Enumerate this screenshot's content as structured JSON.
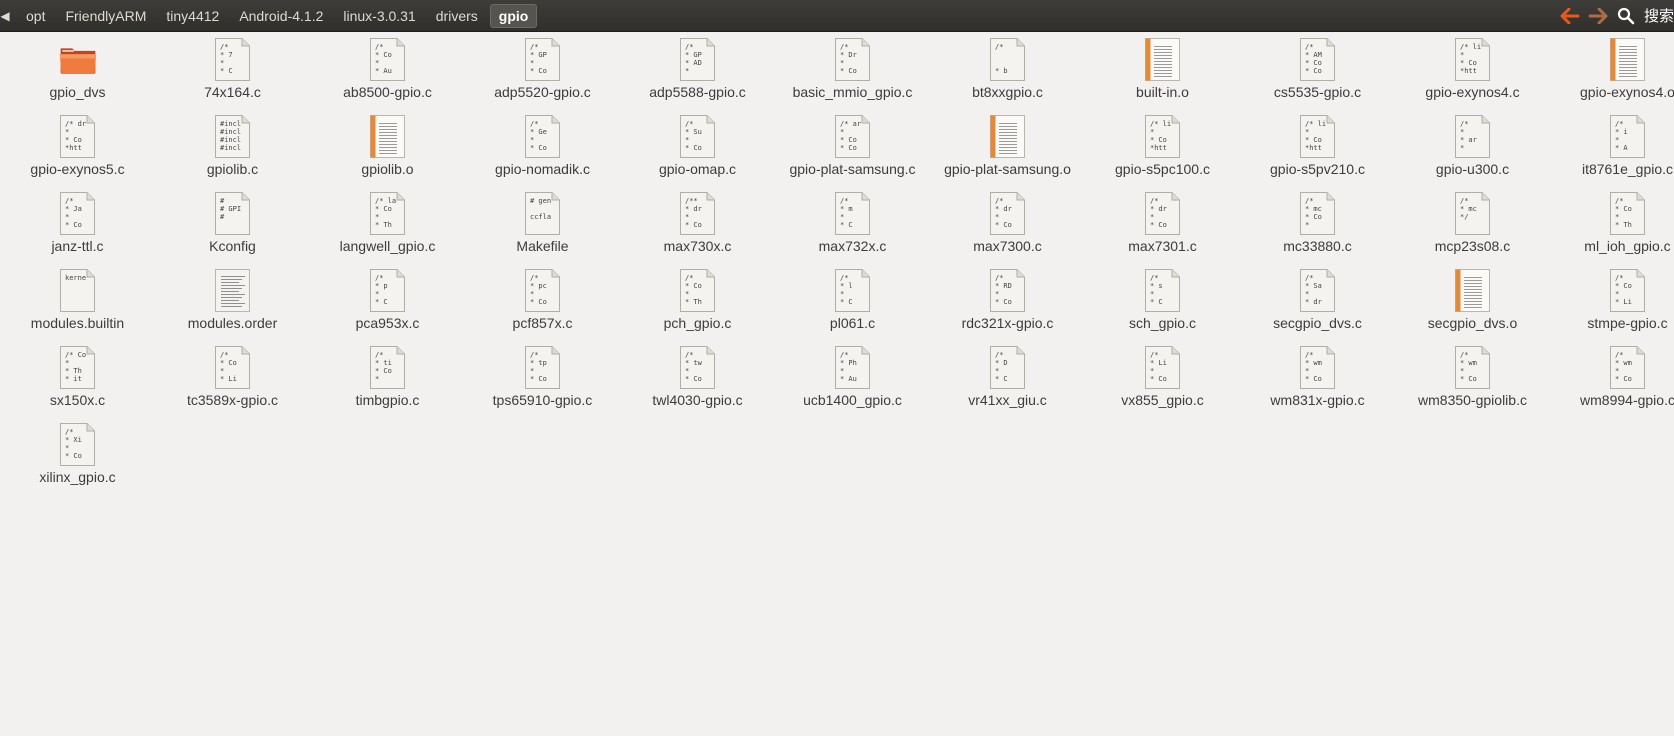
{
  "breadcrumb": {
    "items": [
      "opt",
      "FriendlyARM",
      "tiny4412",
      "Android-4.1.2",
      "linux-3.0.31",
      "drivers",
      "gpio"
    ],
    "active_index": 6
  },
  "toolbar": {
    "search_label": "搜索"
  },
  "colors": {
    "topbar": "#3c3b37",
    "accent_orange": "#e9591e",
    "background": "#f2f1f0"
  },
  "files": [
    {
      "name": "gpio_dvs",
      "type": "folder",
      "icon_text": []
    },
    {
      "name": "74x164.c",
      "type": "code",
      "icon_text": [
        "/*",
        "* 7",
        "*",
        "* C"
      ]
    },
    {
      "name": "ab8500-gpio.c",
      "type": "code",
      "icon_text": [
        "/*",
        "* Co",
        "*",
        "* Au"
      ]
    },
    {
      "name": "adp5520-gpio.c",
      "type": "code",
      "icon_text": [
        "/*",
        "* GP",
        "*",
        "* Co"
      ]
    },
    {
      "name": "adp5588-gpio.c",
      "type": "code",
      "icon_text": [
        "/*",
        "* GP",
        "* AD",
        "*"
      ]
    },
    {
      "name": "basic_mmio_gpio.c",
      "type": "code",
      "icon_text": [
        "/*",
        "* Dr",
        "*",
        "* Co"
      ]
    },
    {
      "name": "bt8xxgpio.c",
      "type": "code",
      "icon_text": [
        "/*",
        "",
        "",
        "* b"
      ]
    },
    {
      "name": "built-in.o",
      "type": "object",
      "icon_text": []
    },
    {
      "name": "cs5535-gpio.c",
      "type": "code",
      "icon_text": [
        "/*",
        "* AM",
        "* Co",
        "* Co"
      ]
    },
    {
      "name": "gpio-exynos4.c",
      "type": "code",
      "icon_text": [
        "/* li",
        "*",
        "* Co",
        "*htt"
      ]
    },
    {
      "name": "gpio-exynos4.o",
      "type": "object",
      "icon_text": []
    },
    {
      "name": "gpio-exynos5.c",
      "type": "code",
      "icon_text": [
        "/* dr",
        "*",
        "* Co",
        "*htt"
      ]
    },
    {
      "name": "gpiolib.c",
      "type": "code",
      "icon_text": [
        "#incl",
        "#incl",
        "#incl",
        "#incl"
      ]
    },
    {
      "name": "gpiolib.o",
      "type": "object",
      "icon_text": []
    },
    {
      "name": "gpio-nomadik.c",
      "type": "code",
      "icon_text": [
        "/*",
        "* Ge",
        "*",
        "* Co"
      ]
    },
    {
      "name": "gpio-omap.c",
      "type": "code",
      "icon_text": [
        "/*",
        "* Su",
        "*",
        "* Co"
      ]
    },
    {
      "name": "gpio-plat-samsung.c",
      "type": "code",
      "icon_text": [
        "/* ar",
        "*",
        "* Co",
        "* Co"
      ]
    },
    {
      "name": "gpio-plat-samsung.o",
      "type": "object",
      "icon_text": []
    },
    {
      "name": "gpio-s5pc100.c",
      "type": "code",
      "icon_text": [
        "/* li",
        "*",
        "* Co",
        "*htt"
      ]
    },
    {
      "name": "gpio-s5pv210.c",
      "type": "code",
      "icon_text": [
        "/* li",
        "*",
        "* Co",
        "*htt"
      ]
    },
    {
      "name": "gpio-u300.c",
      "type": "code",
      "icon_text": [
        "/*",
        "*",
        "* ar",
        "*"
      ]
    },
    {
      "name": "it8761e_gpio.c",
      "type": "code",
      "icon_text": [
        "/*",
        "* i",
        "*",
        "* A"
      ]
    },
    {
      "name": "janz-ttl.c",
      "type": "code",
      "icon_text": [
        "/*",
        "* Ja",
        "*",
        "* Co"
      ]
    },
    {
      "name": "Kconfig",
      "type": "code",
      "icon_text": [
        "#",
        "# GPI",
        "#",
        ""
      ]
    },
    {
      "name": "langwell_gpio.c",
      "type": "code",
      "icon_text": [
        "/* la",
        "* Co",
        "*",
        "* Th"
      ]
    },
    {
      "name": "Makefile",
      "type": "code",
      "icon_text": [
        "# gen",
        "",
        "ccfla",
        ""
      ]
    },
    {
      "name": "max730x.c",
      "type": "code",
      "icon_text": [
        "/**",
        "* dr",
        "*",
        "* Co"
      ]
    },
    {
      "name": "max732x.c",
      "type": "code",
      "icon_text": [
        "/*",
        "* m",
        "*",
        "* C"
      ]
    },
    {
      "name": "max7300.c",
      "type": "code",
      "icon_text": [
        "/*",
        "* dr",
        "*",
        "* Co"
      ]
    },
    {
      "name": "max7301.c",
      "type": "code",
      "icon_text": [
        "/*",
        "* dr",
        "*",
        "* Co"
      ]
    },
    {
      "name": "mc33880.c",
      "type": "code",
      "icon_text": [
        "/*",
        "* mc",
        "* Co",
        "*"
      ]
    },
    {
      "name": "mcp23s08.c",
      "type": "code",
      "icon_text": [
        "/*",
        "* mc",
        "*/",
        ""
      ]
    },
    {
      "name": "ml_ioh_gpio.c",
      "type": "code",
      "icon_text": [
        "/*",
        "* Co",
        "*",
        "* Th"
      ]
    },
    {
      "name": "modules.builtin",
      "type": "code",
      "icon_text": [
        "kerne",
        "",
        "",
        ""
      ]
    },
    {
      "name": "modules.order",
      "type": "text",
      "icon_text": []
    },
    {
      "name": "pca953x.c",
      "type": "code",
      "icon_text": [
        "/*",
        "* p",
        "*",
        "* C"
      ]
    },
    {
      "name": "pcf857x.c",
      "type": "code",
      "icon_text": [
        "/*",
        "* pc",
        "*",
        "* Co"
      ]
    },
    {
      "name": "pch_gpio.c",
      "type": "code",
      "icon_text": [
        "/*",
        "* Co",
        "*",
        "* Th"
      ]
    },
    {
      "name": "pl061.c",
      "type": "code",
      "icon_text": [
        "/*",
        "* l",
        "*",
        "* C"
      ]
    },
    {
      "name": "rdc321x-gpio.c",
      "type": "code",
      "icon_text": [
        "/*",
        "* RD",
        "*",
        "* Co"
      ]
    },
    {
      "name": "sch_gpio.c",
      "type": "code",
      "icon_text": [
        "/*",
        "* s",
        "*",
        "* C"
      ]
    },
    {
      "name": "secgpio_dvs.c",
      "type": "code",
      "icon_text": [
        "/*",
        "* Sa",
        "*",
        "* dr"
      ]
    },
    {
      "name": "secgpio_dvs.o",
      "type": "object",
      "icon_text": []
    },
    {
      "name": "stmpe-gpio.c",
      "type": "code",
      "icon_text": [
        "/*",
        "* Co",
        "*",
        "* Li"
      ]
    },
    {
      "name": "sx150x.c",
      "type": "code",
      "icon_text": [
        "/* Co",
        "*",
        "* Th",
        "* it"
      ]
    },
    {
      "name": "tc3589x-gpio.c",
      "type": "code",
      "icon_text": [
        "/*",
        "* Co",
        "*",
        "* Li"
      ]
    },
    {
      "name": "timbgpio.c",
      "type": "code",
      "icon_text": [
        "/*",
        "* ti",
        "* Co",
        "*"
      ]
    },
    {
      "name": "tps65910-gpio.c",
      "type": "code",
      "icon_text": [
        "/*",
        "* tp",
        "*",
        "* Co"
      ]
    },
    {
      "name": "twl4030-gpio.c",
      "type": "code",
      "icon_text": [
        "/*",
        "* tw",
        "*",
        "* Co"
      ]
    },
    {
      "name": "ucb1400_gpio.c",
      "type": "code",
      "icon_text": [
        "/*",
        "* Ph",
        "*",
        "* Au"
      ]
    },
    {
      "name": "vr41xx_giu.c",
      "type": "code",
      "icon_text": [
        "/*",
        "* D",
        "*",
        "* C"
      ]
    },
    {
      "name": "vx855_gpio.c",
      "type": "code",
      "icon_text": [
        "/*",
        "* Li",
        "*",
        "* Co"
      ]
    },
    {
      "name": "wm831x-gpio.c",
      "type": "code",
      "icon_text": [
        "/*",
        "* wm",
        "*",
        "* Co"
      ]
    },
    {
      "name": "wm8350-gpiolib.c",
      "type": "code",
      "icon_text": [
        "/*",
        "* wm",
        "*",
        "* Co"
      ]
    },
    {
      "name": "wm8994-gpio.c",
      "type": "code",
      "icon_text": [
        "/*",
        "* wm",
        "*",
        "* Co"
      ]
    },
    {
      "name": "xilinx_gpio.c",
      "type": "code",
      "icon_text": [
        "/*",
        "* Xi",
        "*",
        "* Co"
      ]
    }
  ]
}
